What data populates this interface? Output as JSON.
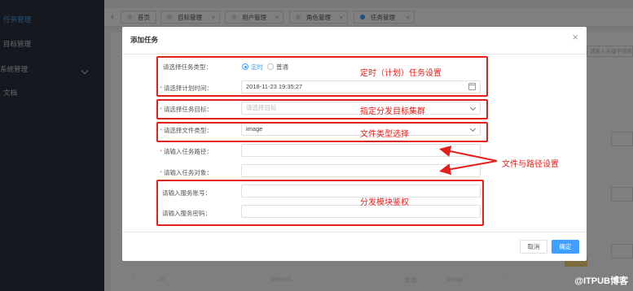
{
  "sidebar": {
    "items": [
      {
        "label": "任务管理"
      },
      {
        "label": "目标管理"
      },
      {
        "label": "系统管理"
      },
      {
        "label": "文档"
      }
    ]
  },
  "tabs": [
    {
      "label": "首页"
    },
    {
      "label": "目标管理"
    },
    {
      "label": "用户管理"
    },
    {
      "label": "角色管理"
    },
    {
      "label": "任务管理"
    }
  ],
  "background": {
    "search_hint": "请输入关键字搜索",
    "row": {
      "id": "26",
      "name": "wtest05",
      "type": "普通",
      "file_type": "image",
      "dash": "-"
    }
  },
  "dialog": {
    "title": "添加任务",
    "close_glyph": "×",
    "task_type": {
      "label": "请选择任务类型：",
      "options": [
        "定时",
        "普通"
      ],
      "selected": "定时"
    },
    "plan_time": {
      "label": "请选择计划时间：",
      "value": "2018-11-23 19:35:27"
    },
    "target": {
      "label": "请选择任务目标：",
      "placeholder": "请选择目标"
    },
    "file_type": {
      "label": "请选择文件类型：",
      "value": "image"
    },
    "path": {
      "label": "请输入任务路径：",
      "value": ""
    },
    "object": {
      "label": "请输入任务对象：",
      "value": ""
    },
    "account": {
      "label": "请输入服务账号：",
      "value": ""
    },
    "password": {
      "label": "请输入服务密码：",
      "value": ""
    },
    "cancel_label": "取消",
    "ok_label": "确定"
  },
  "annotations": {
    "timer": "定时（计划）任务设置",
    "target": "指定分发目标集群",
    "filetype": "文件类型选择",
    "pathset": "文件与路径设置",
    "auth": "分发模块鉴权"
  },
  "watermark": "@ITPUB博客",
  "colors": {
    "accent": "#409eff",
    "annotation": "#e0201b",
    "sidebar": "#2b333e"
  }
}
